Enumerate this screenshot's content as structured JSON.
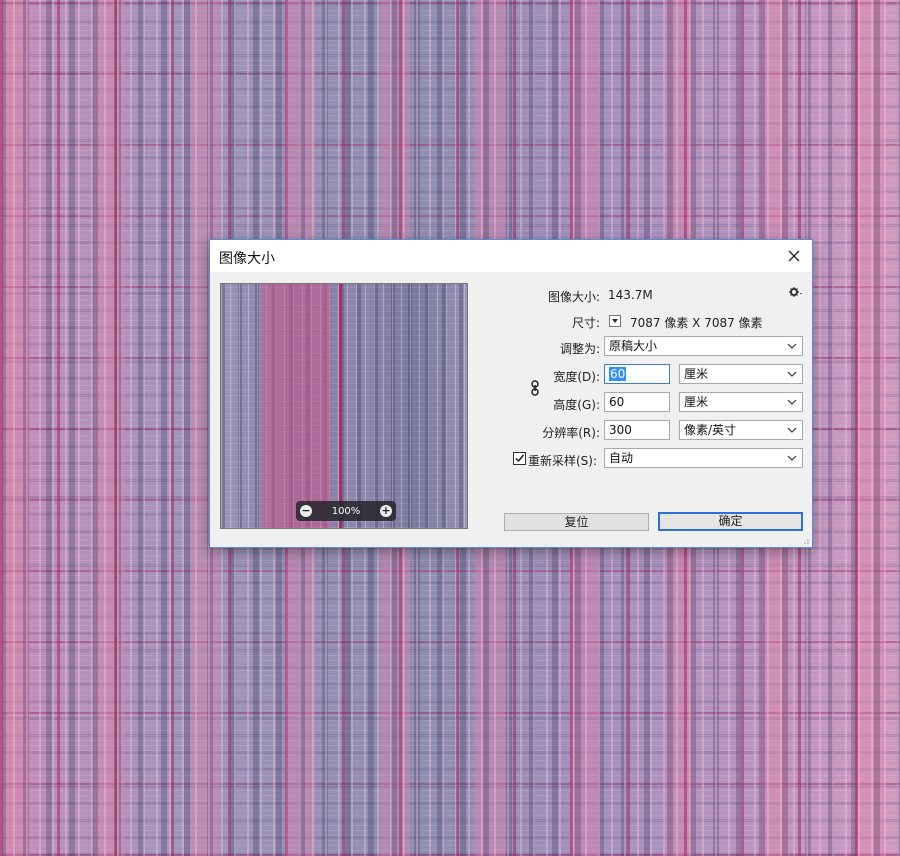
{
  "dialog": {
    "title": "图像大小",
    "image_size_label": "图像大小:",
    "image_size_value": "143.7M",
    "dimensions_label": "尺寸:",
    "dimensions_value": "7087 像素  X  7087 像素",
    "fit_to_label": "调整为:",
    "fit_to_value": "原稿大小",
    "width_label": "宽度(D):",
    "width_value": "60",
    "width_unit": "厘米",
    "height_label": "高度(G):",
    "height_value": "60",
    "height_unit": "厘米",
    "resolution_label": "分辨率(R):",
    "resolution_value": "300",
    "resolution_unit": "像素/英寸",
    "resample_label": "重新采样(S):",
    "resample_checked": true,
    "resample_value": "自动",
    "reset_button": "复位",
    "ok_button": "确定",
    "zoom_level": "100%"
  },
  "icons": {
    "close": "close-icon",
    "gear": "gear-icon",
    "link": "chain-link-icon",
    "zoom_out": "zoom-out-icon",
    "zoom_in": "zoom-in-icon"
  },
  "colors": {
    "accent": "#2a73d6",
    "selection": "#3390ff",
    "dialog_bg": "#f0f0f0"
  }
}
